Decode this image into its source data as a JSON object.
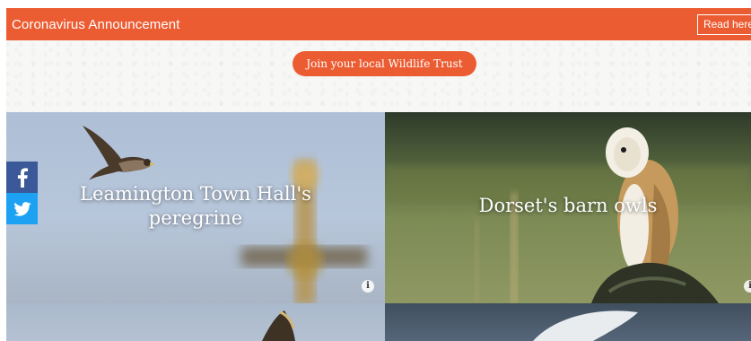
{
  "announcement": {
    "text": "Coronavirus Announcement",
    "button_label": "Read here"
  },
  "join_button_label": "Join your local Wildlife Trust",
  "tiles": [
    {
      "title": "Leamington Town Hall's peregrine",
      "info_icon": "i"
    },
    {
      "title": "Dorset's barn owls",
      "info_icon": "i"
    }
  ],
  "social": [
    {
      "name": "facebook",
      "icon": "facebook-icon",
      "color": "#3b5998"
    },
    {
      "name": "twitter",
      "icon": "twitter-icon",
      "color": "#1da1f2"
    }
  ],
  "colors": {
    "accent": "#ec5c32"
  }
}
